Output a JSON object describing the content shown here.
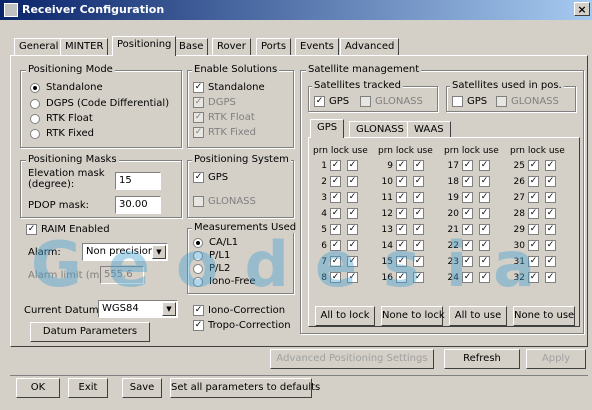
{
  "window": {
    "title": "Receiver Configuration",
    "close": "×"
  },
  "tabs": [
    "General",
    "MINTER",
    "Positioning",
    "Base",
    "Rover",
    "Ports",
    "Events",
    "Advanced"
  ],
  "positioning_mode": {
    "legend": "Positioning Mode",
    "options": [
      "Standalone",
      "DGPS (Code Differential)",
      "RTK Float",
      "RTK Fixed"
    ],
    "selected": "Standalone"
  },
  "enable_solutions": {
    "legend": "Enable Solutions",
    "items": [
      {
        "label": "Standalone",
        "checked": true,
        "enabled": true
      },
      {
        "label": "DGPS",
        "checked": true,
        "enabled": false
      },
      {
        "label": "RTK Float",
        "checked": true,
        "enabled": false
      },
      {
        "label": "RTK Fixed",
        "checked": true,
        "enabled": false
      }
    ]
  },
  "positioning_masks": {
    "legend": "Positioning Masks",
    "elevation_label": "Elevation mask (degree):",
    "elevation_value": "15",
    "pdop_label": "PDOP mask:",
    "pdop_value": "30.00"
  },
  "positioning_system": {
    "legend": "Positioning System",
    "gps": "GPS",
    "glonass": "GLONASS"
  },
  "raim": {
    "enabled_label": "RAIM Enabled",
    "alarm_label": "Alarm:",
    "alarm_value": "Non precision",
    "alarm_limit_label": "Alarm limit (m):",
    "alarm_limit_value": "555.6"
  },
  "datum": {
    "current_label": "Current Datum:",
    "current_value": "WGS84",
    "params_button": "Datum Parameters"
  },
  "measurements": {
    "legend": "Measurements Used",
    "options": [
      "CA/L1",
      "P/L1",
      "P/L2",
      "Iono-Free"
    ],
    "selected": "CA/L1"
  },
  "corrections": {
    "iono": "Iono-Correction",
    "tropo": "Tropo-Correction"
  },
  "satellite_mgmt": {
    "legend": "Satellite management",
    "tracked_legend": "Satellites tracked",
    "used_legend": "Satellites used in pos.",
    "gps": "GPS",
    "glonass": "GLONASS",
    "inner_tabs": [
      "GPS",
      "GLONASS",
      "WAAS"
    ],
    "col_header": "prn lock use",
    "prns": [
      1,
      2,
      3,
      4,
      5,
      6,
      7,
      8,
      9,
      10,
      11,
      12,
      13,
      14,
      15,
      16,
      17,
      18,
      19,
      20,
      21,
      22,
      23,
      24,
      25,
      26,
      27,
      28,
      29,
      30,
      31,
      32
    ],
    "buttons": [
      "All to lock",
      "None to lock",
      "All to use",
      "None to use"
    ]
  },
  "dialog_buttons": {
    "advanced": "Advanced Positioning Settings",
    "refresh": "Refresh",
    "apply": "Apply"
  },
  "footer_buttons": {
    "ok": "OK",
    "exit": "Exit",
    "save": "Save",
    "defaults": "Set all parameters to defaults"
  },
  "watermark": "Geodesia"
}
